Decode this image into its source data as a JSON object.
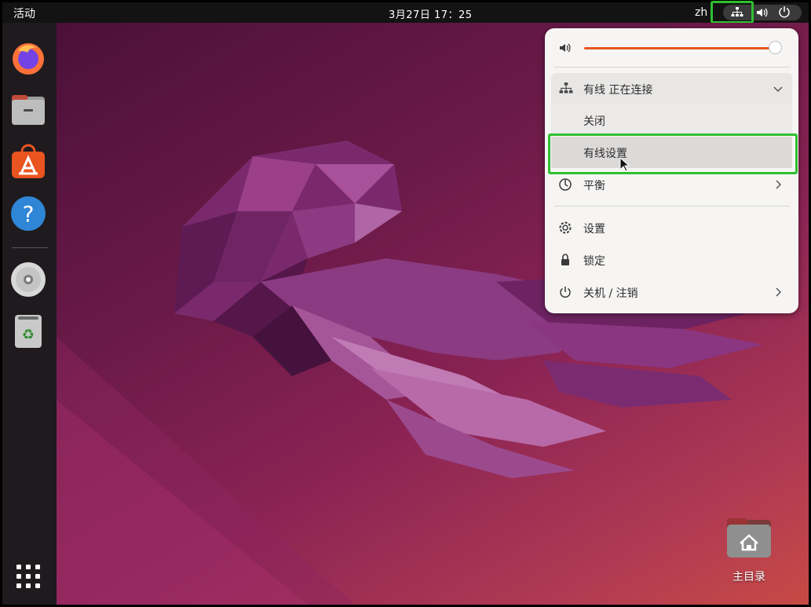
{
  "topbar": {
    "activities": "活动",
    "clock": "3月27日  17：25",
    "lang": "zh",
    "icons": [
      "network-icon",
      "volume-icon",
      "power-icon"
    ]
  },
  "dock": {
    "items": [
      "firefox",
      "files",
      "app-center",
      "help",
      "disc",
      "trash",
      "show-apps"
    ]
  },
  "menu": {
    "volume_level": 0.97,
    "wired_header": "有线 正在连接",
    "wired_off": "关闭",
    "wired_settings": "有线设置",
    "power_mode": "平衡",
    "settings": "设置",
    "lock": "锁定",
    "shutdown": "关机 / 注销"
  },
  "desktop": {
    "home_label": "主目录"
  },
  "colors": {
    "accent": "#e95420",
    "highlight": "#2fbf2f"
  }
}
